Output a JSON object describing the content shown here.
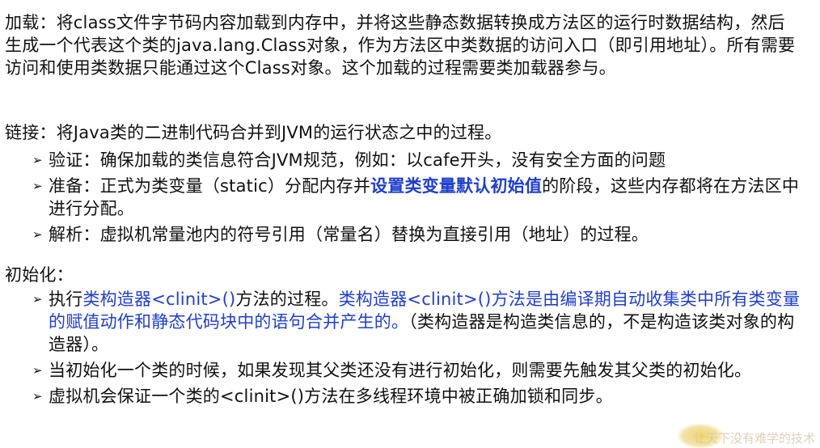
{
  "loading": {
    "text": "加载：将class文件字节码内容加载到内存中，并将这些静态数据转换成方法区的运行时数据结构，然后生成一个代表这个类的java.lang.Class对象，作为方法区中类数据的访问入口（即引用地址）。所有需要访问和使用类数据只能通过这个Class对象。这个加载的过程需要类加载器参与。"
  },
  "linking": {
    "heading": "链接：将Java类的二进制代码合并到JVM的运行状态之中的过程。",
    "bullets": {
      "verify": "验证：确保加载的类信息符合JVM规范，例如：以cafe开头，没有安全方面的问题",
      "prepare_before": "准备：正式为类变量（static）分配内存并",
      "prepare_highlight": "设置类变量默认初始值",
      "prepare_after": "的阶段，这些内存都将在方法区中进行分配。",
      "resolve": "解析：虚拟机常量池内的符号引用（常量名）替换为直接引用（地址）的过程。"
    }
  },
  "initialization": {
    "heading": "初始化：",
    "bullets": {
      "exec_prefix": "执行",
      "exec_blue1": "类构造器<clinit>()",
      "exec_mid": "方法的过程。",
      "exec_blue2": "类构造器<clinit>()方法是由编译期自动收集类中所有类变量的赋值动作和静态代码块中的语句合并产生的。",
      "exec_after": "（类构造器是构造类信息的，不是构造该类对象的构造器）。",
      "parent": "当初始化一个类的时候，如果发现其父类还没有进行初始化，则需要先触发其父类的初始化。",
      "lock": "虚拟机会保证一个类的<clinit>()方法在多线程环境中被正确加锁和同步。"
    }
  },
  "bullet_glyph": "➢",
  "watermark": "让天下没有难学的技术"
}
